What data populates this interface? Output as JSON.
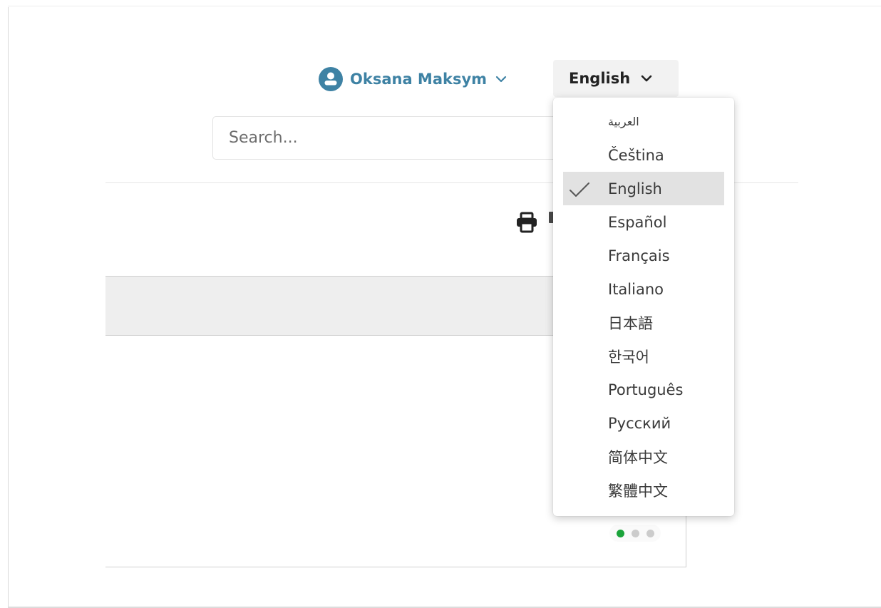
{
  "header": {
    "user_name": "Oksana Maksym",
    "language_button_label": "English"
  },
  "search": {
    "placeholder": "Search..."
  },
  "language_menu": {
    "selected": "English",
    "items": [
      "العربية",
      "Čeština",
      "English",
      "Español",
      "Français",
      "Italiano",
      "日本語",
      "한국어",
      "Português",
      "Русский",
      "简体中文",
      "繁體中文"
    ]
  },
  "carousel": {
    "dot_count": 3,
    "active_index": 0
  },
  "icons": {
    "user": "user-circle-icon",
    "chevron": "chevron-down-icon",
    "print": "printer-icon",
    "check": "check-icon"
  },
  "colors": {
    "accent": "#3e82a4",
    "active_dot": "#1aa33a",
    "selected_item_bg": "#e2e2e2",
    "language_button_bg": "#f2f2f2"
  }
}
